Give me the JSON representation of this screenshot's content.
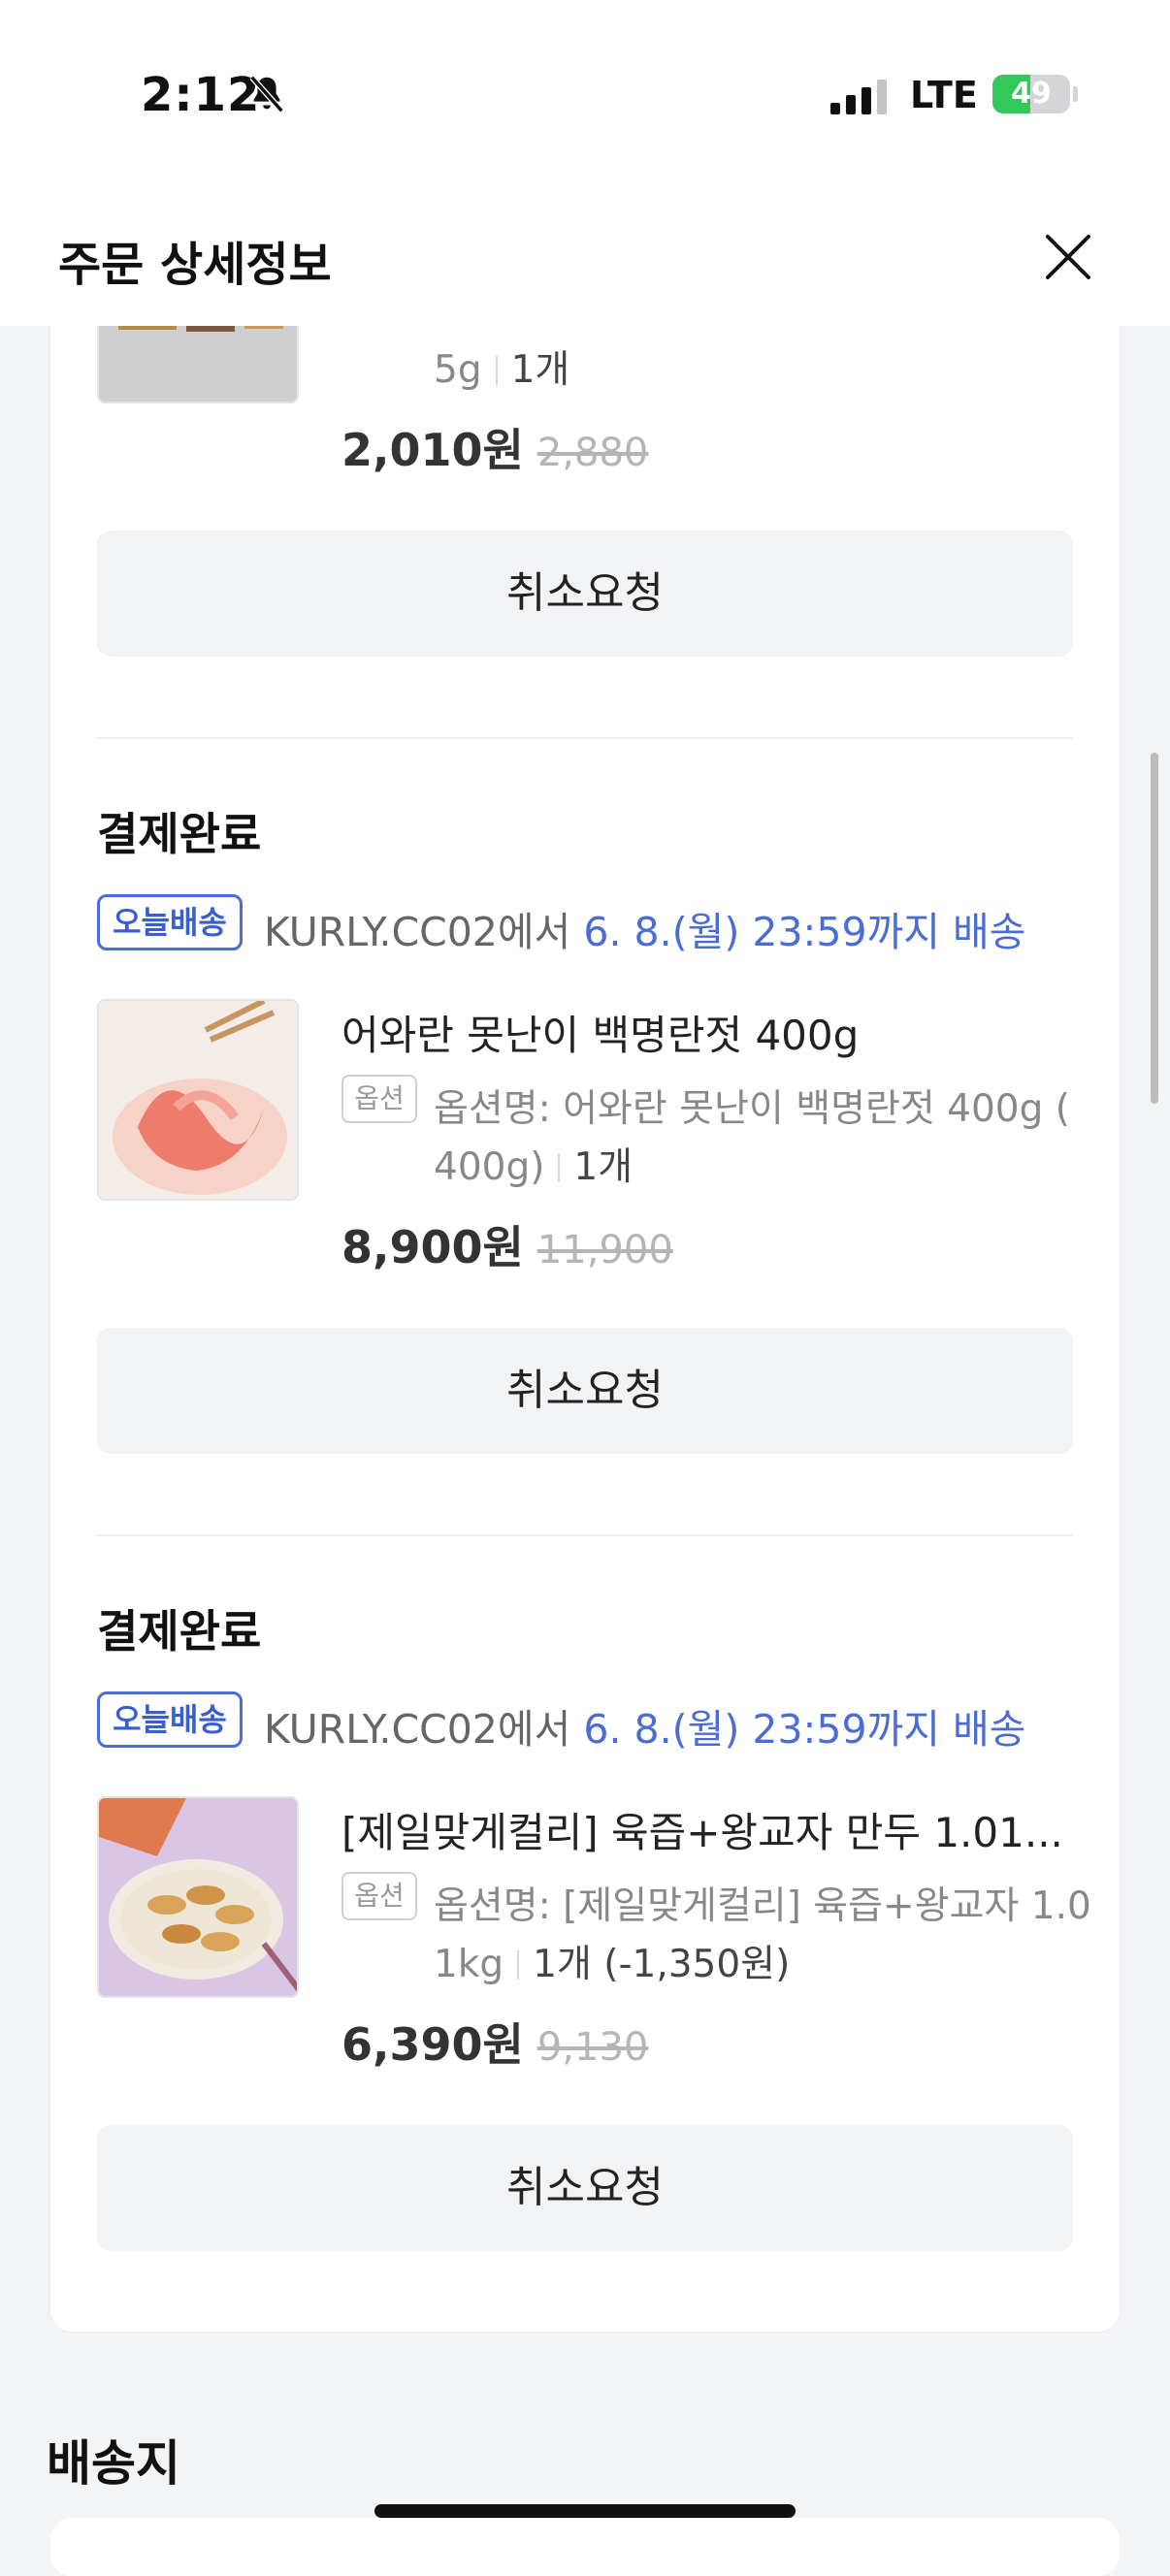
{
  "status_bar": {
    "time": "2:12",
    "network": "LTE",
    "battery": "49",
    "battery_level": 0.49
  },
  "header": {
    "title": "주문 상세정보"
  },
  "items": [
    {
      "status": "",
      "option_badge": "",
      "option_text": "5g",
      "quantity": "1개",
      "price": "2,010원",
      "original_price": "2,880",
      "cancel_label": "취소요청"
    },
    {
      "status": "결제완료",
      "delivery_badge": "오늘배송",
      "delivery_from": "KURLY.CC02에서 ",
      "delivery_due": "6. 8.(월) 23:59까지 배송",
      "name": "어와란 못난이 백명란젓 400g",
      "option_badge": "옵션",
      "option_line1": "옵션명: 어와란 못난이 백명란젓 400g (",
      "option_line2": "400g)",
      "quantity": "1개",
      "price": "8,900원",
      "original_price": "11,900",
      "cancel_label": "취소요청"
    },
    {
      "status": "결제완료",
      "delivery_badge": "오늘배송",
      "delivery_from": "KURLY.CC02에서 ",
      "delivery_due": "6. 8.(월) 23:59까지 배송",
      "name": "[제일맞게컬리] 육즙+왕교자 만두 1.01...",
      "option_badge": "옵션",
      "option_line1": "옵션명: [제일맞게컬리] 육즙+왕교자 1.0",
      "option_line2": "1kg",
      "quantity": "1개 (-1,350원)",
      "price": "6,390원",
      "original_price": "9,130",
      "cancel_label": "취소요청"
    }
  ],
  "address": {
    "title": "배송지"
  },
  "colors": {
    "accent": "#4a6cd4",
    "battery": "#34c759"
  }
}
